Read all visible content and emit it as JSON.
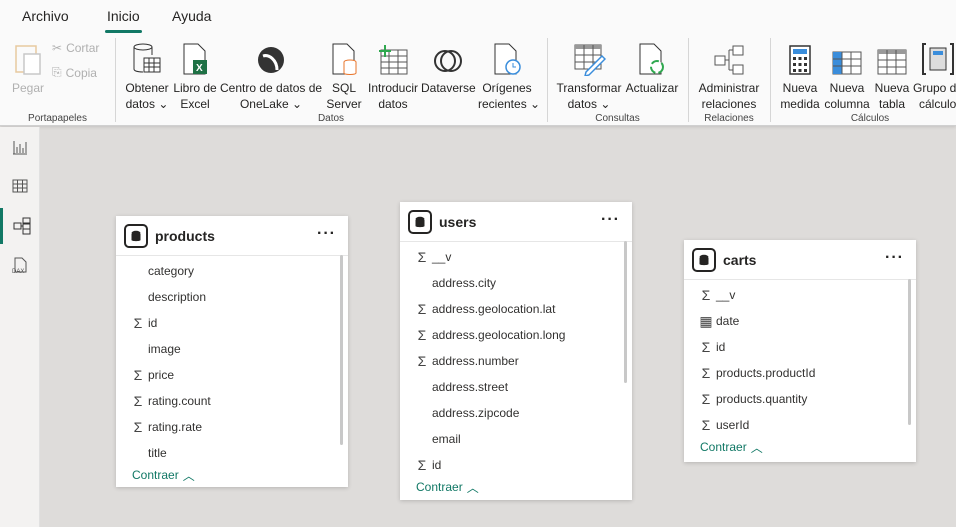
{
  "menu": {
    "tabs": [
      {
        "label": "Archivo"
      },
      {
        "label": "Inicio",
        "active": true
      },
      {
        "label": "Ayuda"
      }
    ]
  },
  "ribbon": {
    "clipboard": {
      "paste": "Pegar",
      "cut": "Cortar",
      "copy": "Copia",
      "group": "Portapapeles"
    },
    "data": {
      "get_data": [
        "Obtener",
        "datos"
      ],
      "excel": [
        "Libro de",
        "Excel"
      ],
      "onelake": [
        "Centro de datos de",
        "OneLake"
      ],
      "sql": [
        "SQL",
        "Server"
      ],
      "enter": [
        "Introducir",
        "datos"
      ],
      "dataverse": "Dataverse",
      "recent": [
        "Orígenes",
        "recientes"
      ],
      "group": "Datos"
    },
    "queries": {
      "transform": [
        "Transformar",
        "datos"
      ],
      "refresh": "Actualizar",
      "group": "Consultas"
    },
    "relations": {
      "manage": [
        "Administrar",
        "relaciones"
      ],
      "group": "Relaciones"
    },
    "calc": {
      "measure": [
        "Nueva",
        "medida"
      ],
      "column": [
        "Nueva",
        "columna"
      ],
      "table": [
        "Nueva",
        "tabla"
      ],
      "calc_group": [
        "Grupo de",
        "cálculo"
      ],
      "group": "Cálculos"
    }
  },
  "rail": [
    "report-view",
    "table-view",
    "model-view",
    "dax-query-view"
  ],
  "colors": {
    "accent": "#117865",
    "excel": "#1e7145",
    "sql": "#e8742a",
    "refresh": "#2fa84f",
    "blue": "#3a8ddb"
  },
  "tables": [
    {
      "name": "products",
      "collapse": "Contraer",
      "fields": [
        {
          "name": "category",
          "type": "text"
        },
        {
          "name": "description",
          "type": "text"
        },
        {
          "name": "id",
          "type": "sum"
        },
        {
          "name": "image",
          "type": "text"
        },
        {
          "name": "price",
          "type": "sum"
        },
        {
          "name": "rating.count",
          "type": "sum"
        },
        {
          "name": "rating.rate",
          "type": "sum"
        },
        {
          "name": "title",
          "type": "text"
        }
      ]
    },
    {
      "name": "users",
      "collapse": "Contraer",
      "fields": [
        {
          "name": "__v",
          "type": "sum"
        },
        {
          "name": "address.city",
          "type": "text"
        },
        {
          "name": "address.geolocation.lat",
          "type": "sum"
        },
        {
          "name": "address.geolocation.long",
          "type": "sum"
        },
        {
          "name": "address.number",
          "type": "sum"
        },
        {
          "name": "address.street",
          "type": "text"
        },
        {
          "name": "address.zipcode",
          "type": "text"
        },
        {
          "name": "email",
          "type": "text"
        },
        {
          "name": "id",
          "type": "sum"
        }
      ]
    },
    {
      "name": "carts",
      "collapse": "Contraer",
      "fields": [
        {
          "name": "__v",
          "type": "sum"
        },
        {
          "name": "date",
          "type": "date"
        },
        {
          "name": "id",
          "type": "sum"
        },
        {
          "name": "products.productId",
          "type": "sum"
        },
        {
          "name": "products.quantity",
          "type": "sum"
        },
        {
          "name": "userId",
          "type": "sum"
        }
      ]
    }
  ]
}
